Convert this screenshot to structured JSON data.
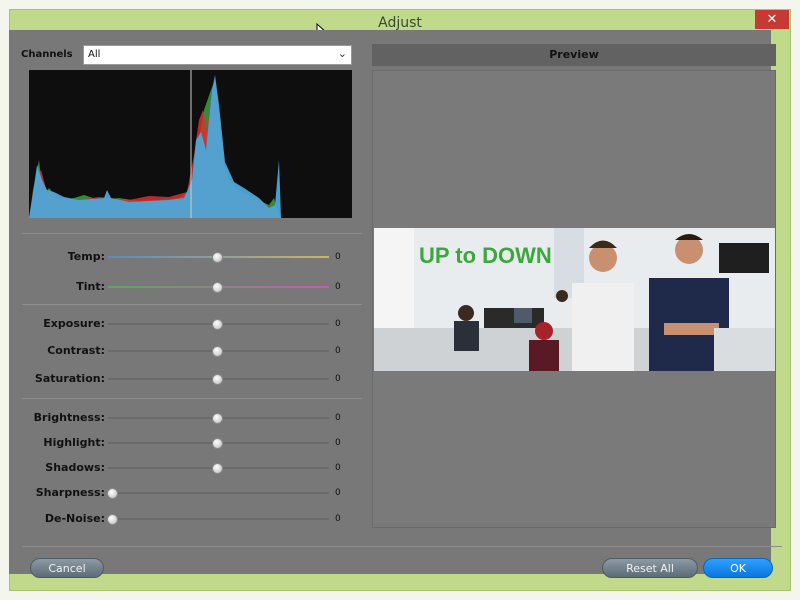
{
  "window": {
    "title": "Adjust",
    "close_glyph": "✕"
  },
  "channels": {
    "label": "Channels",
    "value": "All"
  },
  "preview": {
    "header": "Preview",
    "logo_text": "UP to DOWN"
  },
  "sliders": [
    {
      "label": "Temp:",
      "value": "0",
      "level": 0.5
    },
    {
      "label": "Tint:",
      "value": "0",
      "level": 0.5
    },
    {
      "label": "Exposure:",
      "value": "0",
      "level": 0.5
    },
    {
      "label": "Contrast:",
      "value": "0",
      "level": 0.5
    },
    {
      "label": "Saturation:",
      "value": "0",
      "level": 0.5
    },
    {
      "label": "Brightness:",
      "value": "0",
      "level": 0.5
    },
    {
      "label": "Highlight:",
      "value": "0",
      "level": 0.5
    },
    {
      "label": "Shadows:",
      "value": "0",
      "level": 0.5
    },
    {
      "label": "Sharpness:",
      "value": "0",
      "level": 0.0
    },
    {
      "label": "De-Noise:",
      "value": "0",
      "level": 0.0
    }
  ],
  "buttons": {
    "cancel": "Cancel",
    "reset_all": "Reset All",
    "ok": "OK"
  },
  "colors": {
    "frame": "#c0d98b",
    "panel": "#787878",
    "close": "#c73a33",
    "ok": "#1a8cf0",
    "histogram_blue": "#4ea5d8",
    "histogram_red": "#d83030",
    "histogram_green": "#3aa040"
  }
}
